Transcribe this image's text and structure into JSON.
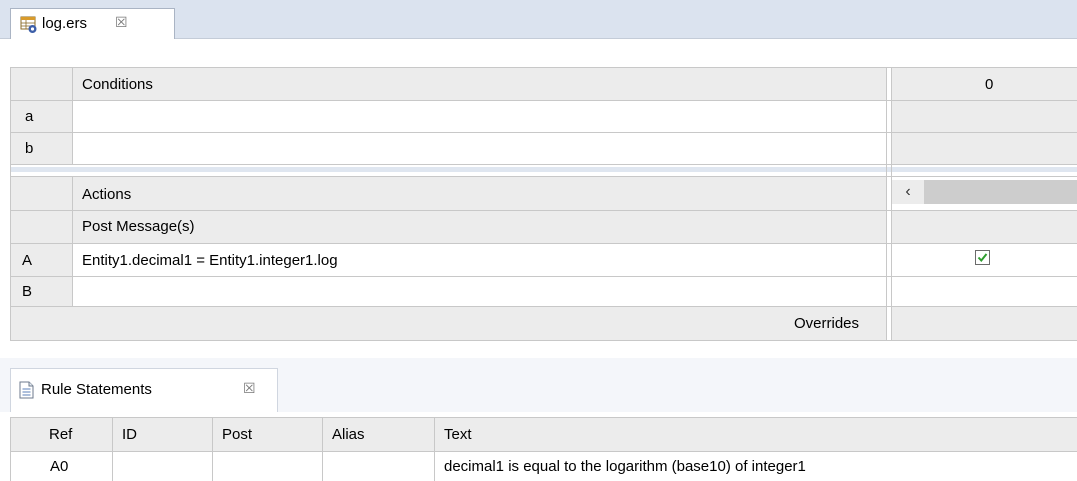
{
  "editor": {
    "tab_title": "log.ers",
    "tab_icon": "rule-sheet-icon",
    "close_glyph": "☒"
  },
  "conditions": {
    "header": "Conditions",
    "column_number": "0",
    "rows": [
      {
        "id": "a",
        "text": ""
      },
      {
        "id": "b",
        "text": ""
      }
    ]
  },
  "actions": {
    "header": "Actions",
    "post_message_label": "Post Message(s)",
    "scroll_left_glyph": "‹",
    "rows": [
      {
        "id": "A",
        "text": "Entity1.decimal1 = Entity1.integer1.log",
        "checked": true
      },
      {
        "id": "B",
        "text": "",
        "checked": false
      }
    ],
    "overrides_label": "Overrides"
  },
  "rule_statements": {
    "tab_title": "Rule Statements",
    "tab_icon": "document-icon",
    "close_glyph": "☒",
    "columns": [
      "Ref",
      "ID",
      "Post",
      "Alias",
      "Text"
    ],
    "rows": [
      {
        "ref": "A0",
        "id": "",
        "post": "",
        "alias": "",
        "text": "decimal1 is equal to the logarithm (base10) of integer1"
      }
    ]
  },
  "colors": {
    "tab_strip": "#dbe3ef",
    "cell_gray": "#ececec",
    "grid_line": "#c8c8c8",
    "check_green": "#2f9e2f"
  }
}
